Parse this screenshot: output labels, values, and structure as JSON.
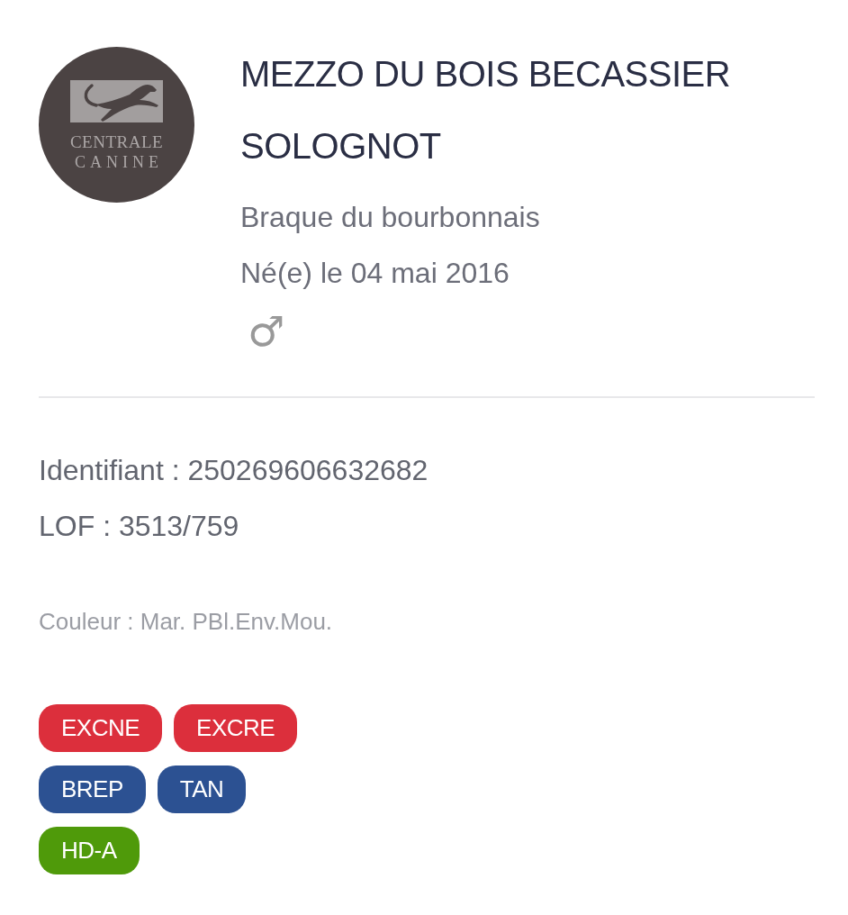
{
  "logo": {
    "lines": [
      "CENTRALE",
      "CANINE"
    ]
  },
  "dog": {
    "name": "MEZZO DU BOIS BECASSIER SOLOGNOT",
    "breed": "Braque du bourbonnais",
    "birth": "Né(e) le 04 mai 2016",
    "sex_symbol": "♂"
  },
  "details": [
    "Identifiant : 250269606632682",
    "LOF : 3513/759"
  ],
  "coat": "Couleur : Mar. PBl.Env.Mou.",
  "badge_rows": [
    {
      "badges": [
        {
          "label": "EXCNE",
          "color": "#dc2f3c"
        },
        {
          "label": "EXCRE",
          "color": "#dc2f3c"
        }
      ]
    },
    {
      "badges": [
        {
          "label": "BREP",
          "color": "#2c5192"
        },
        {
          "label": "TAN",
          "color": "#2c5192"
        }
      ]
    },
    {
      "badges": [
        {
          "label": "HD-A",
          "color": "#4f9a0a"
        }
      ]
    }
  ]
}
